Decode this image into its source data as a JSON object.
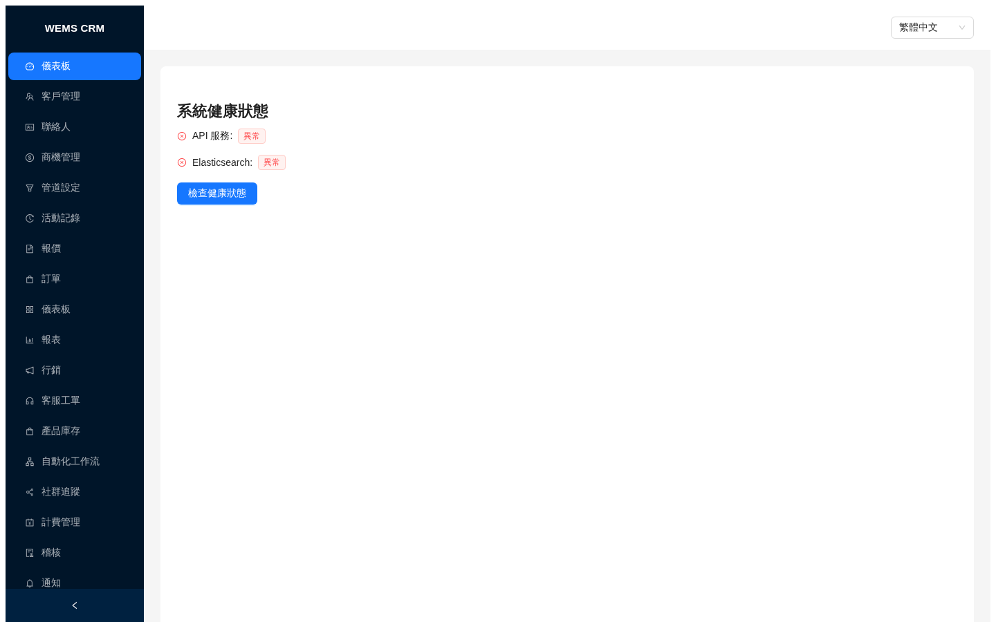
{
  "sidebar": {
    "logo": "WEMS CRM",
    "items": [
      {
        "label": "儀表板",
        "selected": true
      },
      {
        "label": "客戶管理",
        "selected": false
      },
      {
        "label": "聯絡人",
        "selected": false
      },
      {
        "label": "商機管理",
        "selected": false
      },
      {
        "label": "管道設定",
        "selected": false
      },
      {
        "label": "活動記錄",
        "selected": false
      },
      {
        "label": "報價",
        "selected": false
      },
      {
        "label": "訂單",
        "selected": false
      },
      {
        "label": "儀表板",
        "selected": false
      },
      {
        "label": "報表",
        "selected": false
      },
      {
        "label": "行銷",
        "selected": false
      },
      {
        "label": "客服工單",
        "selected": false
      },
      {
        "label": "產品庫存",
        "selected": false
      },
      {
        "label": "自動化工作流",
        "selected": false
      },
      {
        "label": "社群追蹤",
        "selected": false
      },
      {
        "label": "計費管理",
        "selected": false
      },
      {
        "label": "稽核",
        "selected": false
      },
      {
        "label": "通知",
        "selected": false
      }
    ]
  },
  "header": {
    "language_select": {
      "value": "繁體中文"
    }
  },
  "health_card": {
    "title": "系統健康狀態",
    "services": [
      {
        "name": "API 服務:",
        "status": "異常",
        "healthy": false
      },
      {
        "name": "Elasticsearch:",
        "status": "異常",
        "healthy": false
      }
    ],
    "check_button": "檢查健康狀態"
  }
}
